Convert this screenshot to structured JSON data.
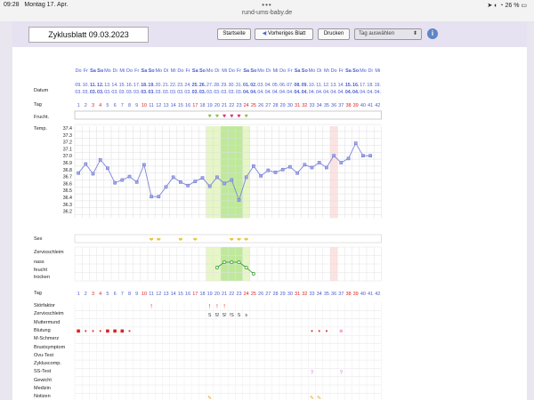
{
  "status": {
    "time": "09:28",
    "date": "Montag 17. Apr.",
    "url": "rund-ums-baby.de",
    "battery": "26 %",
    "dots": "•••"
  },
  "toolbar": {
    "title": "Zyklusblatt 09.03.2023",
    "start": "Startseite",
    "prev": "Vorheriges Blatt",
    "print": "Drucken",
    "select": "Tag auswählen",
    "info": "i"
  },
  "labels": {
    "date": "Datum",
    "day": "Tag",
    "fertile": "Frucht.",
    "temp": "Temp.",
    "sex": "Sex",
    "mucus": "Zervixschleim",
    "nass": "nass",
    "feucht": "feucht",
    "trocken": "trocken",
    "day2": "Tag"
  },
  "weekdays": [
    "Do",
    "Fr",
    "Sa",
    "So",
    "Mo",
    "Di",
    "Mi",
    "Do",
    "Fr",
    "Sa",
    "So",
    "Mo",
    "Di",
    "Mi",
    "Do",
    "Fr",
    "Sa",
    "So",
    "Mo",
    "Di",
    "Mi",
    "Do",
    "Fr",
    "Sa",
    "So",
    "Mo",
    "Di",
    "Mi",
    "Do",
    "Fr",
    "Sa",
    "So",
    "Mo",
    "Di",
    "Mi",
    "Do",
    "Fr",
    "Sa",
    "So",
    "Mo",
    "Di",
    "Mi"
  ],
  "dates_day": [
    "09.",
    "10.",
    "11.",
    "12.",
    "13.",
    "14.",
    "15.",
    "16.",
    "17.",
    "18.",
    "19.",
    "20.",
    "21.",
    "22.",
    "23.",
    "24.",
    "25.",
    "26.",
    "27.",
    "28.",
    "29.",
    "30.",
    "31.",
    "01.",
    "02.",
    "03.",
    "04.",
    "05.",
    "06.",
    "07.",
    "08.",
    "09.",
    "10.",
    "11.",
    "12.",
    "13.",
    "14.",
    "15.",
    "16.",
    "17.",
    "18.",
    "19."
  ],
  "dates_month": [
    "03.",
    "03.",
    "03.",
    "03.",
    "03.",
    "03.",
    "03.",
    "03.",
    "03.",
    "03.",
    "03.",
    "03.",
    "03.",
    "03.",
    "03.",
    "03.",
    "03.",
    "03.",
    "03.",
    "03.",
    "03.",
    "03.",
    "03.",
    "04.",
    "04.",
    "04.",
    "04.",
    "04.",
    "04.",
    "04.",
    "04.",
    "04.",
    "04.",
    "04.",
    "04.",
    "04.",
    "04.",
    "04.",
    "04.",
    "04.",
    "04.",
    "04."
  ],
  "days": [
    "1",
    "2",
    "3",
    "4",
    "5",
    "6",
    "7",
    "8",
    "9",
    "10",
    "11",
    "12",
    "13",
    "14",
    "15",
    "16",
    "17",
    "18",
    "19",
    "20",
    "21",
    "22",
    "23",
    "24",
    "25",
    "26",
    "27",
    "28",
    "29",
    "30",
    "31",
    "32",
    "33",
    "34",
    "35",
    "36",
    "37",
    "38",
    "39",
    "40",
    "41",
    "42"
  ],
  "temp_axis": [
    "37.4",
    "37.3",
    "37.2",
    "37.1",
    "37.0",
    "36.9",
    "36.8",
    "36.7",
    "36.6",
    "36.5",
    "36.4",
    "36.3",
    "36.2"
  ],
  "chart_data": {
    "type": "line",
    "x": [
      1,
      2,
      3,
      4,
      5,
      6,
      7,
      8,
      9,
      10,
      11,
      12,
      13,
      14,
      15,
      16,
      17,
      18,
      19,
      20,
      21,
      22,
      23,
      24,
      25,
      26,
      27,
      28,
      29,
      30,
      31,
      32,
      33,
      34,
      35,
      36,
      37,
      38,
      39,
      40
    ],
    "values": [
      36.75,
      36.88,
      36.74,
      36.94,
      36.82,
      36.61,
      36.65,
      36.7,
      36.62,
      36.87,
      36.41,
      36.41,
      36.55,
      36.69,
      36.62,
      36.57,
      36.63,
      36.68,
      36.56,
      36.69,
      36.6,
      36.65,
      36.36,
      36.69,
      36.85,
      36.71,
      36.79,
      36.76,
      36.8,
      36.84,
      36.75,
      36.87,
      36.83,
      36.9,
      36.83,
      37.0,
      36.9,
      36.96,
      37.18,
      37.0
    ],
    "extra_point": {
      "x": 41,
      "y": 37.0
    },
    "ylim": [
      36.2,
      37.4
    ]
  },
  "symptoms": [
    "Störfaktor",
    "Zervixschleim",
    "Muttermund",
    "Blutung",
    "M-Schmerz",
    "Brustsymptom",
    "Ovu-Test",
    "Zykluscomp.",
    "SS-Test",
    "Gewicht",
    "Medizin",
    "Notizen"
  ],
  "mucus_marks": {
    "days": [
      19,
      20,
      21,
      22,
      23,
      24
    ],
    "labels": [
      "S",
      "S!",
      "S!",
      "!S",
      "S",
      "s"
    ]
  },
  "stoer_marks": {
    "days": [
      11,
      19,
      20,
      21
    ],
    "label": "!"
  },
  "sstest_marks": {
    "days": [
      33,
      37
    ],
    "label": "?"
  }
}
